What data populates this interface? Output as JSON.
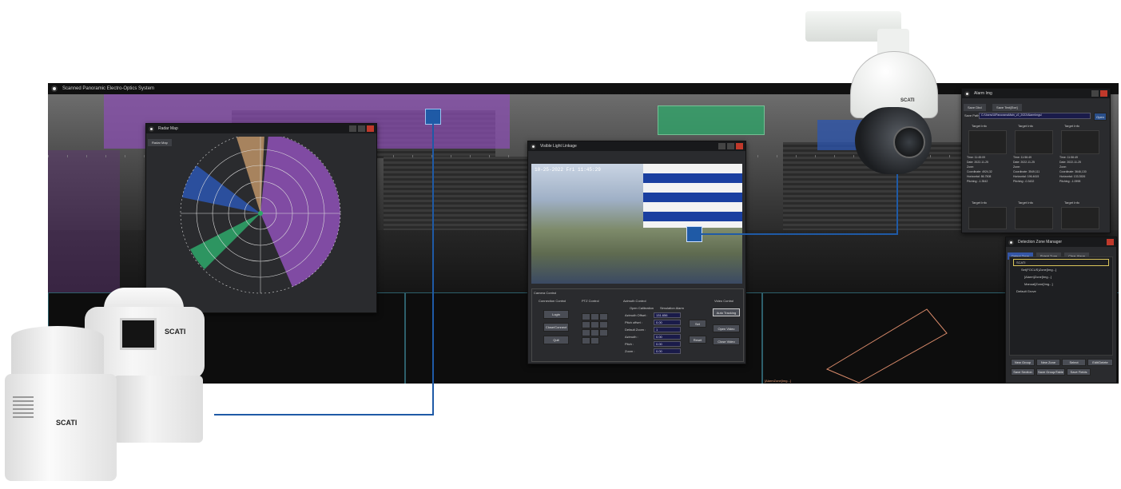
{
  "app": {
    "title": "Scanned Panoramic Electro-Optics System"
  },
  "radar_window": {
    "title": "Radar Map",
    "tab": "Radar Map"
  },
  "visible_window": {
    "title": "Visible Light Linkage",
    "timestamp": "10-25-2022 Fri 11:45:29",
    "sections": {
      "camera_control": "Camera Control",
      "connection_control": "Connection Control",
      "ptz_control": "PTZ Control",
      "azimuth_control": "Azimuth Control",
      "video_control": "Video Control",
      "open_calibration": "Open Calibration",
      "simulation_alarm": "Simulation Alarm"
    },
    "connection_buttons": [
      "Login",
      "Close/Connect",
      "Quit"
    ],
    "azimuth_labels": [
      "Azimuth Offset :",
      "Pitch offset :",
      "Default Zoom :",
      "Azimuth :",
      "Pitch :",
      "Zoom :"
    ],
    "azimuth_values": [
      "131.656",
      "0.00",
      "1",
      "0.00",
      "0.00",
      "0.00"
    ],
    "azimuth_buttons": [
      "Set",
      "Reset"
    ],
    "video_buttons": [
      "Auto Tracking",
      "Open Video",
      "Close Video"
    ]
  },
  "alarm_window": {
    "title": "Alarm Img",
    "tabs": [
      "Save Dbd",
      "Save Text[Exe]"
    ],
    "save_path_label": "Save Path",
    "save_path_value": "C:/Users/UIPanoramaMain_v2_2022/AlarmImgs/",
    "open_label": "Open",
    "cards": [
      {
        "title": "Target Info",
        "lines": [
          "Time: 11:45:09",
          "Date: 2022-11-25",
          "Zone: ",
          "Coordinate: 4924,32",
          "Horizontal: 86.7508",
          "Pitching: -1.3542"
        ]
      },
      {
        "title": "Target Info",
        "lines": [
          "Time: 11:56:49",
          "Date: 2022-11-25",
          "Zone: ",
          "Coordinate: 3549,111",
          "Horizontal: 196.4615",
          "Pitching: -0.3432"
        ]
      },
      {
        "title": "Target Info",
        "lines": [
          "Time: 11:56:49",
          "Date: 2022-11-25",
          "Zone: ",
          "Coordinate: 3646,130",
          "Horizontal: 133.3526",
          "Pitching: -1.0998"
        ]
      },
      {
        "title": "Target Info",
        "lines": []
      },
      {
        "title": "Target Info",
        "lines": []
      },
      {
        "title": "Target Info",
        "lines": []
      }
    ]
  },
  "zone_window": {
    "title": "Detection Zone Manager",
    "tabs": [
      "Detect Zone",
      "Shield Zone",
      "Clear Alarm"
    ],
    "tree": [
      "SCATI",
      "Set(FOCUS)Zone[Img...]",
      "[Alarm]Zone[Img...]",
      "Manual[Zone[Img...]",
      "Default Grove"
    ],
    "buttons_row1": [
      "New Group",
      "New Zone",
      "Select",
      "Edit/Delete"
    ],
    "buttons_row2": [
      "Save Section",
      "Save Group/Table",
      "Save Fields"
    ]
  },
  "overlay_label": "[AlarmZone]Img...]",
  "brand": "SCATI",
  "colors": {
    "accent_blue": "#1f5aa6",
    "zone_purple": "#8a4fb0",
    "zone_blue": "#2c56b0",
    "zone_green": "#2ea86a",
    "zone_orange": "#c79a6a",
    "close_red": "#c0392b"
  }
}
